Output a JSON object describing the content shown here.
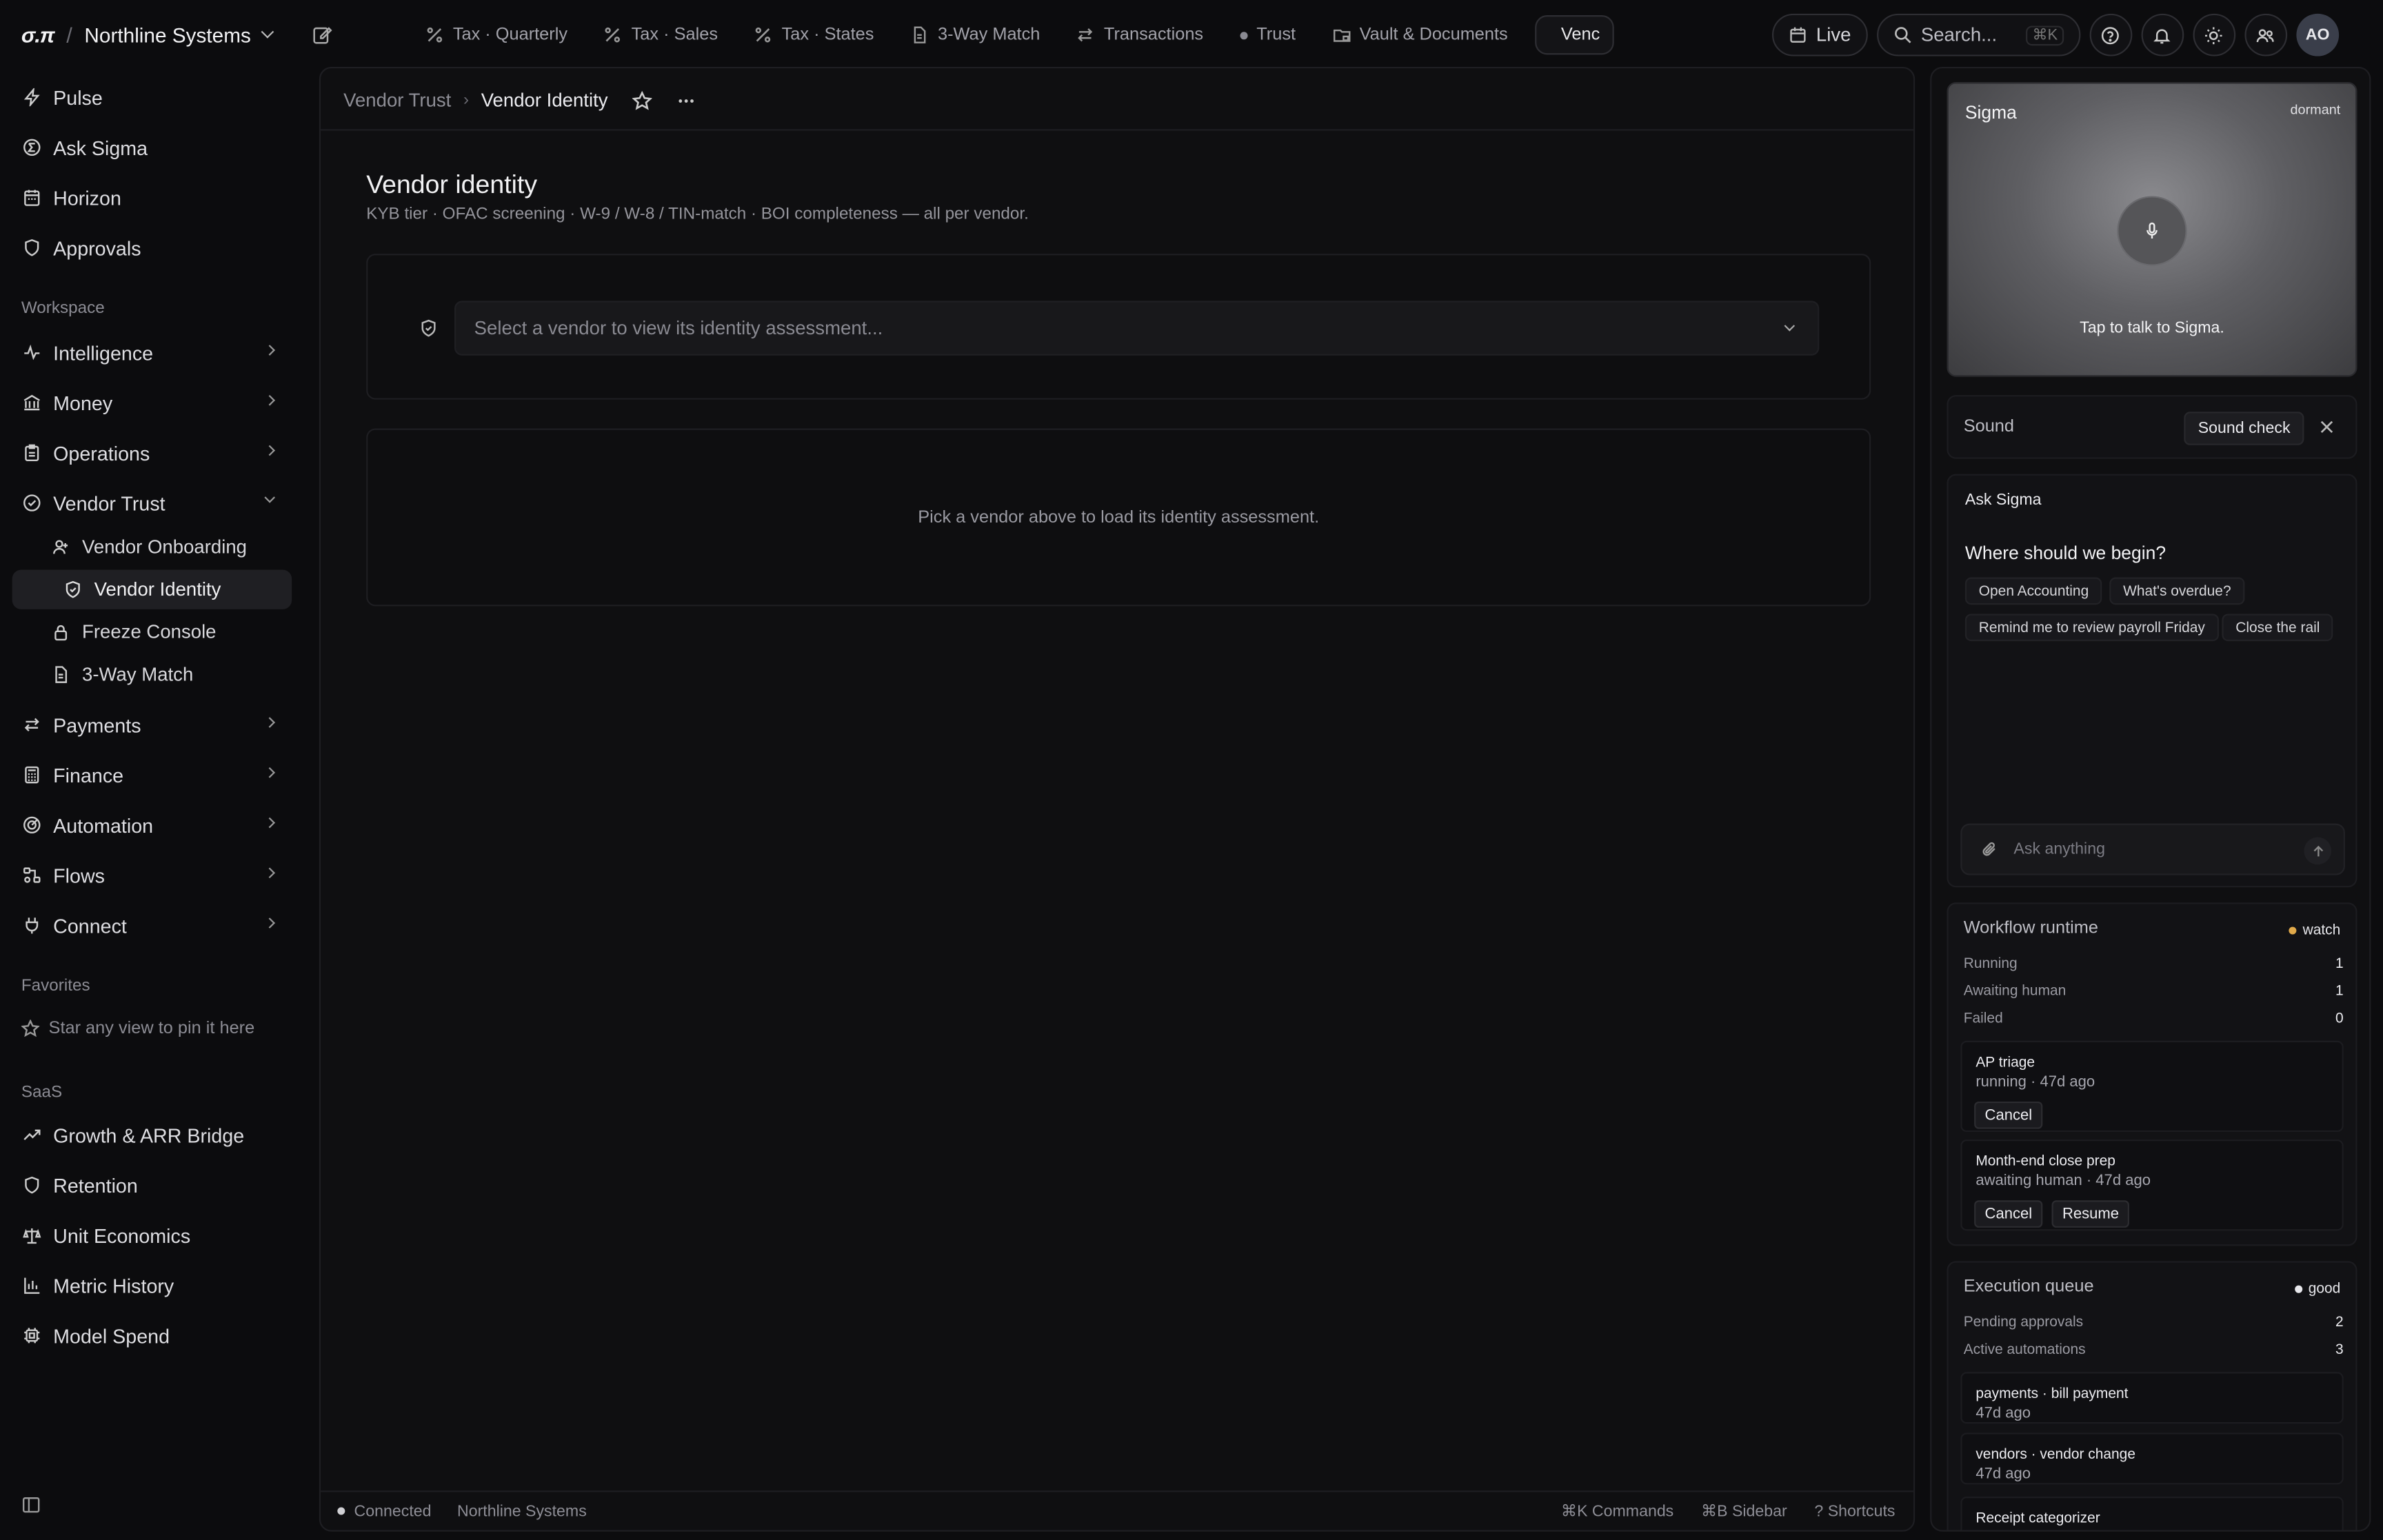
{
  "topbar": {
    "logo": "σ.π",
    "org": "Northline Systems",
    "tabs": [
      {
        "label": "Tax · Quarterly",
        "icon": "percent-icon"
      },
      {
        "label": "Tax · Sales",
        "icon": "percent-icon"
      },
      {
        "label": "Tax · States",
        "icon": "percent-icon"
      },
      {
        "label": "3-Way Match",
        "icon": "document-icon"
      },
      {
        "label": "Transactions",
        "icon": "arrows-swap-icon"
      },
      {
        "label": "Trust",
        "icon": "dot-icon"
      },
      {
        "label": "Vault & Documents",
        "icon": "folder-lock-icon"
      },
      {
        "label": "Vendor Identity",
        "icon": "shield-check-icon"
      }
    ],
    "active_tab_visible": "Venc",
    "live_label": "Live",
    "search_placeholder": "Search...",
    "search_shortcut": "⌘K",
    "avatar_initials": "AO"
  },
  "sidebar": {
    "top_items": [
      {
        "label": "Pulse"
      },
      {
        "label": "Ask Sigma"
      },
      {
        "label": "Horizon"
      },
      {
        "label": "Approvals"
      }
    ],
    "workspace_label": "Workspace",
    "workspace_items": [
      {
        "label": "Intelligence"
      },
      {
        "label": "Money"
      },
      {
        "label": "Operations"
      },
      {
        "label": "Vendor Trust"
      }
    ],
    "vendor_trust_sub": [
      {
        "label": "Vendor Onboarding"
      },
      {
        "label": "Vendor Identity"
      },
      {
        "label": "Freeze Console"
      },
      {
        "label": "3-Way Match"
      }
    ],
    "more_items": [
      {
        "label": "Payments"
      },
      {
        "label": "Finance"
      },
      {
        "label": "Automation"
      },
      {
        "label": "Flows"
      },
      {
        "label": "Connect"
      }
    ],
    "favorites_label": "Favorites",
    "favorites_hint": "Star any view to pin it here",
    "saas_label": "SaaS",
    "saas_items": [
      {
        "label": "Growth & ARR Bridge"
      },
      {
        "label": "Retention"
      },
      {
        "label": "Unit Economics"
      },
      {
        "label": "Metric History"
      },
      {
        "label": "Model Spend"
      }
    ]
  },
  "main": {
    "breadcrumb_parent": "Vendor Trust",
    "breadcrumb_current": "Vendor Identity",
    "title": "Vendor identity",
    "subtitle": "KYB tier · OFAC screening · W-9 / W-8 / TIN-match · BOI completeness — all per vendor.",
    "select_placeholder": "Select a vendor to view its identity assessment...",
    "empty_text": "Pick a vendor above to load its identity assessment."
  },
  "statusbar": {
    "connected": "Connected",
    "org": "Northline Systems",
    "commands": "⌘K Commands",
    "sidebar": "⌘B Sidebar",
    "shortcuts": "? Shortcuts"
  },
  "rail": {
    "sigma_title": "Sigma",
    "sigma_state": "dormant",
    "tap_text": "Tap to talk to Sigma.",
    "sound_label": "Sound",
    "sound_check": "Sound check",
    "ask_header": "Ask Sigma",
    "ask_question": "Where should we begin?",
    "chips": [
      "Open Accounting",
      "What's overdue?",
      "Remind me to review payroll Friday",
      "Close the rail"
    ],
    "ask_placeholder": "Ask anything",
    "workflow": {
      "title": "Workflow runtime",
      "badge": "watch",
      "badge_color": "#e0a94a",
      "stats": [
        {
          "label": "Running",
          "value": "1"
        },
        {
          "label": "Awaiting human",
          "value": "1"
        },
        {
          "label": "Failed",
          "value": "0"
        }
      ],
      "jobs": [
        {
          "title": "AP triage",
          "status": "running · 47d ago",
          "buttons": [
            "Cancel"
          ]
        },
        {
          "title": "Month-end close prep",
          "status": "awaiting human · 47d ago",
          "buttons": [
            "Cancel",
            "Resume"
          ]
        }
      ]
    },
    "queue": {
      "title": "Execution queue",
      "badge": "good",
      "badge_color": "#e8e8ec",
      "stats": [
        {
          "label": "Pending approvals",
          "value": "2"
        },
        {
          "label": "Active automations",
          "value": "3"
        }
      ],
      "items": [
        {
          "title": "payments · bill payment",
          "status": "47d ago"
        },
        {
          "title": "vendors · vendor change",
          "status": "47d ago"
        },
        {
          "title": "Receipt categorizer",
          "status": ""
        }
      ]
    }
  }
}
